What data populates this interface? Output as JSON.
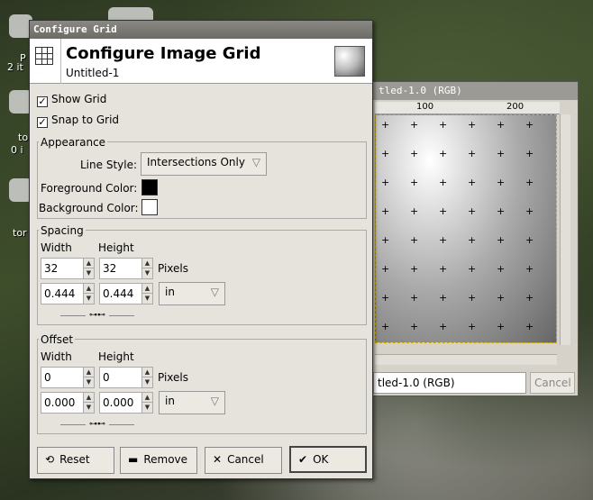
{
  "desktop": {
    "icons": [
      {
        "label": "P"
      },
      {
        "label": "2 it"
      },
      {
        "label": "to"
      },
      {
        "label": "0 i"
      },
      {
        "label": "tor"
      }
    ]
  },
  "image_window": {
    "title": "tled-1.0 (RGB)",
    "ruler_100": "100",
    "ruler_200": "200",
    "status": "tled-1.0 (RGB)",
    "cancel_label": "Cancel"
  },
  "dialog": {
    "window_title": "Configure Grid",
    "header_title": "Configure Image Grid",
    "header_subtitle": "Untitled-1",
    "show_grid": {
      "label": "Show Grid",
      "checked": true
    },
    "snap_to_grid": {
      "label": "Snap to Grid",
      "checked": true
    },
    "appearance": {
      "label": "Appearance",
      "line_style_label": "Line Style:",
      "line_style_value": "Intersections Only",
      "foreground_label": "Foreground Color:",
      "foreground_color": "#000000",
      "background_label": "Background Color:",
      "background_color": "#ffffff"
    },
    "spacing": {
      "label": "Spacing",
      "width_label": "Width",
      "height_label": "Height",
      "width_px": "32",
      "height_px": "32",
      "unit_px": "Pixels",
      "width_in": "0.444",
      "height_in": "0.444",
      "unit": "in"
    },
    "offset": {
      "label": "Offset",
      "width_label": "Width",
      "height_label": "Height",
      "width_px": "0",
      "height_px": "0",
      "unit_px": "Pixels",
      "width_in": "0.000",
      "height_in": "0.000",
      "unit": "in"
    },
    "buttons": {
      "reset": "Reset",
      "remove": "Remove",
      "cancel": "Cancel",
      "ok": "OK"
    }
  }
}
